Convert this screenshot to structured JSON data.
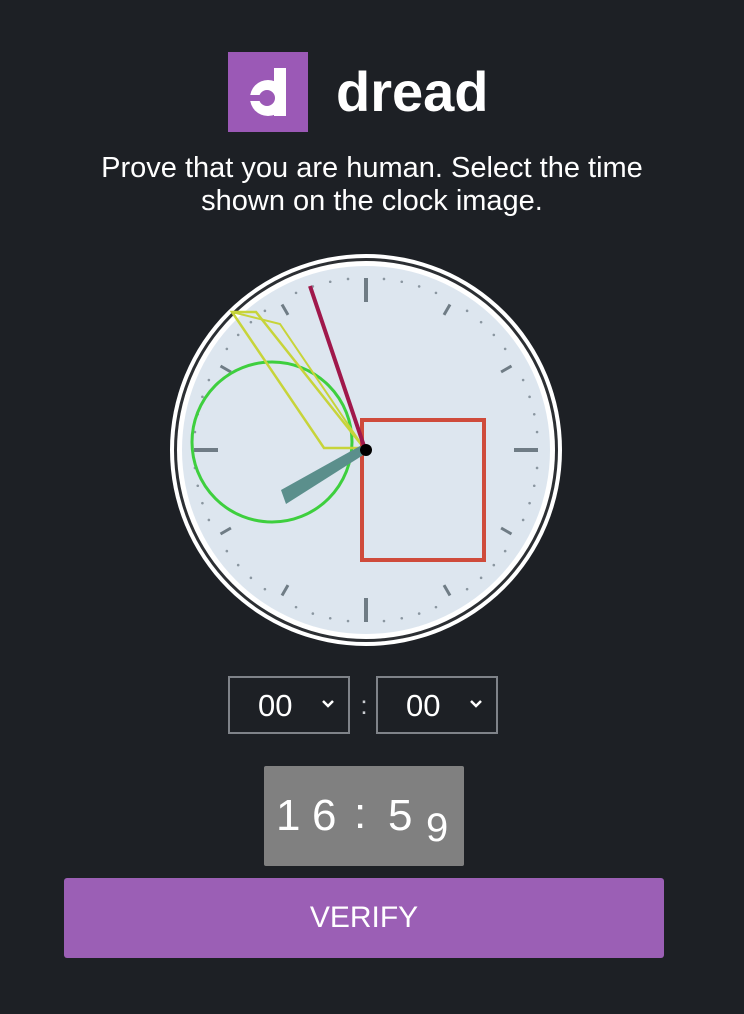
{
  "brand": {
    "name": "dread",
    "logo_letter": "d",
    "logo_color": "#9b59b6"
  },
  "instruction": {
    "line1": "Prove that you are human. Select the time",
    "line2": "shown on the clock image."
  },
  "clock": {
    "hour_hand": {
      "color": "#5b8f8c"
    },
    "minute_hand": {
      "color": "#a0184b"
    },
    "distractors": [
      {
        "shape": "circle",
        "color": "#3ecf3e"
      },
      {
        "shape": "rectangle",
        "color": "#cf4b3b"
      },
      {
        "shape": "polygon",
        "color": "#c7d43a"
      }
    ]
  },
  "time_select": {
    "hours_value": "00",
    "minutes_value": "00",
    "separator": ":"
  },
  "captcha": {
    "chars": [
      "1",
      "6",
      ":",
      "5",
      "9"
    ]
  },
  "verify_button": {
    "label": "VERIFY",
    "color": "#9b5fb5"
  }
}
